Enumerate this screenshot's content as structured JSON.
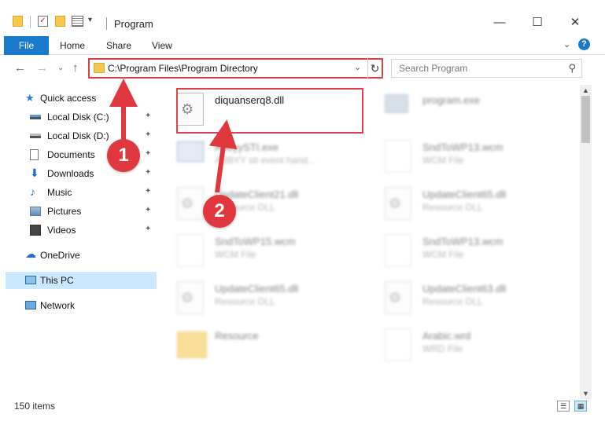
{
  "window": {
    "title": "Program",
    "minimize_glyph": "—",
    "maximize_glyph": "☐",
    "close_glyph": "✕"
  },
  "ribbon": {
    "file_label": "File",
    "home_label": "Home",
    "share_label": "Share",
    "view_label": "View",
    "collapse_glyph": "⌄",
    "help_glyph": "?"
  },
  "address": {
    "path": "C:\\Program Files\\Program Directory",
    "dropdown_glyph": "⌄",
    "refresh_glyph": "↻"
  },
  "search": {
    "placeholder": "Search Program",
    "icon_glyph": "⚲"
  },
  "nav": {
    "back_glyph": "←",
    "forward_glyph": "→",
    "recent_glyph": "⌄",
    "up_glyph": "↑"
  },
  "sidebar": {
    "pin_glyph": "✦",
    "items": [
      {
        "label": "Quick access"
      },
      {
        "label": "Local Disk (C:)"
      },
      {
        "label": "Local Disk (D:)"
      },
      {
        "label": "Documents"
      },
      {
        "label": "Downloads"
      },
      {
        "label": "Music"
      },
      {
        "label": "Pictures"
      },
      {
        "label": "Videos"
      },
      {
        "label": "OneDrive"
      },
      {
        "label": "This PC"
      },
      {
        "label": "Network"
      }
    ]
  },
  "files": [
    {
      "name": "diquanserq8.dll",
      "type": ""
    },
    {
      "name": "program.exe",
      "type": ""
    },
    {
      "name": "AbbyySTI.exe",
      "type": "ABBYY sti event hand..."
    },
    {
      "name": "SndToWP13.wcm",
      "type": "WCM File"
    },
    {
      "name": "UpdateClient21.dll",
      "type": "Resource DLL"
    },
    {
      "name": "UpdateClient65.dll",
      "type": "Resource DLL"
    },
    {
      "name": "SndToWP15.wcm",
      "type": "WCM File"
    },
    {
      "name": "SndToWP13.wcm",
      "type": "WCM File"
    },
    {
      "name": "UpdateClient65.dll",
      "type": "Resource DLL"
    },
    {
      "name": "UpdateClient63.dll",
      "type": "Resource DLL"
    },
    {
      "name": "Resource",
      "type": ""
    },
    {
      "name": "Arabic.wrd",
      "type": "WRD File"
    }
  ],
  "status": {
    "item_count": "150 items"
  },
  "annotations": {
    "step1": "1",
    "step2": "2",
    "color": "#e0383e"
  },
  "colors": {
    "accent": "#1979ca",
    "highlight_border": "#d9424b",
    "selection": "#cce8ff"
  }
}
